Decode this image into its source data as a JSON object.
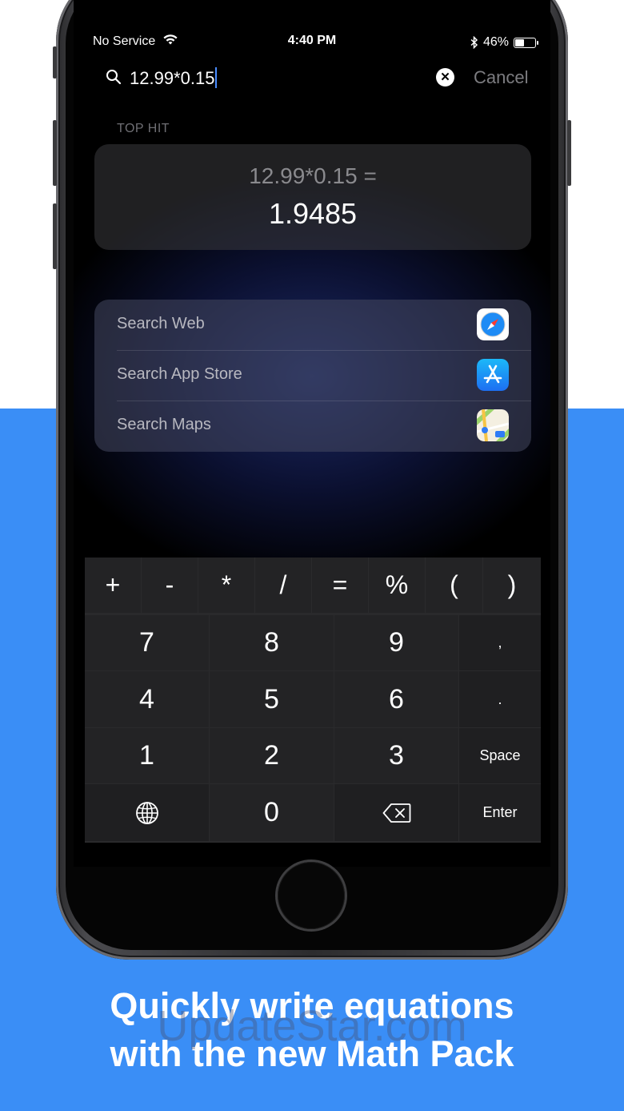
{
  "status_bar": {
    "carrier": "No Service",
    "time": "4:40 PM",
    "battery": "46%"
  },
  "search": {
    "query": "12.99*0.15",
    "cancel_label": "Cancel"
  },
  "top_hit": {
    "section_label": "TOP HIT",
    "expression": "12.99*0.15 =",
    "result": "1.9485"
  },
  "suggestions": [
    {
      "label": "Search Web",
      "icon": "safari-icon"
    },
    {
      "label": "Search App Store",
      "icon": "app-store-icon"
    },
    {
      "label": "Search Maps",
      "icon": "maps-icon"
    }
  ],
  "keyboard": {
    "operators": [
      "+",
      "-",
      "*",
      "/",
      "=",
      "%",
      "(",
      ")"
    ],
    "rows": [
      [
        "7",
        "8",
        "9",
        ","
      ],
      [
        "4",
        "5",
        "6",
        "."
      ],
      [
        "1",
        "2",
        "3",
        "Space"
      ],
      [
        "globe-icon",
        "0",
        "delete-icon",
        "Enter"
      ]
    ]
  },
  "caption": {
    "line1": "Quickly write equations",
    "line2": "with the new Math Pack"
  },
  "watermark": "UpdateStar.com",
  "colors": {
    "background_top": "#ffffff",
    "background_bottom": "#3a8ef6",
    "accent": "#4a8cff"
  }
}
